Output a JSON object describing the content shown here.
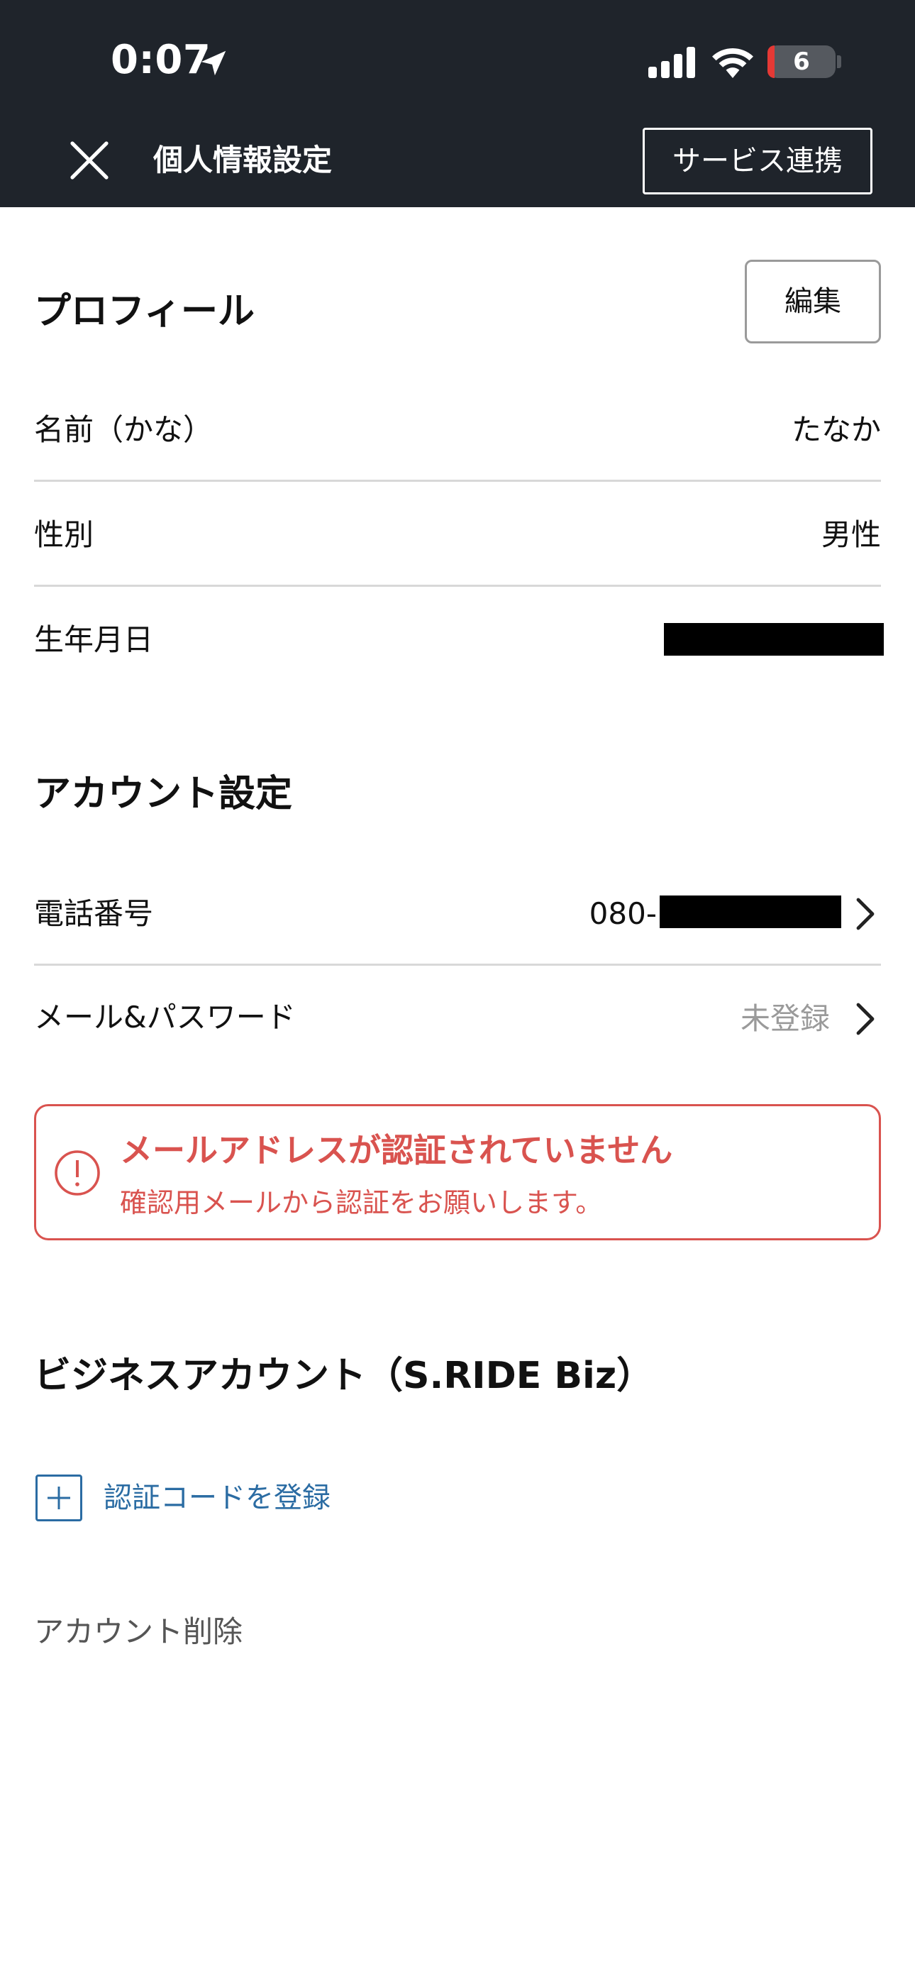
{
  "status_bar": {
    "time": "0:07",
    "battery_level": "6"
  },
  "header": {
    "title": "個人情報設定",
    "service_button": "サービス連携"
  },
  "profile": {
    "title": "プロフィール",
    "edit_button": "編集",
    "rows": [
      {
        "label": "名前（かな）",
        "value": "たなか"
      },
      {
        "label": "性別",
        "value": "男性"
      },
      {
        "label": "生年月日",
        "value": ""
      }
    ]
  },
  "account": {
    "title": "アカウント設定",
    "phone_label": "電話番号",
    "phone_prefix": "080-",
    "mail_label": "メール&パスワード",
    "mail_value": "未登録"
  },
  "alert": {
    "title": "メールアドレスが認証されていません",
    "body": "確認用メールから認証をお願いします。"
  },
  "business": {
    "title": "ビジネスアカウント（S.RIDE Biz）",
    "register_code": "認証コードを登録"
  },
  "delete_account": "アカウント削除",
  "colors": {
    "header_bg": "#1f242b",
    "alert_red": "#d9534f",
    "link_blue": "#2b6ca3"
  }
}
